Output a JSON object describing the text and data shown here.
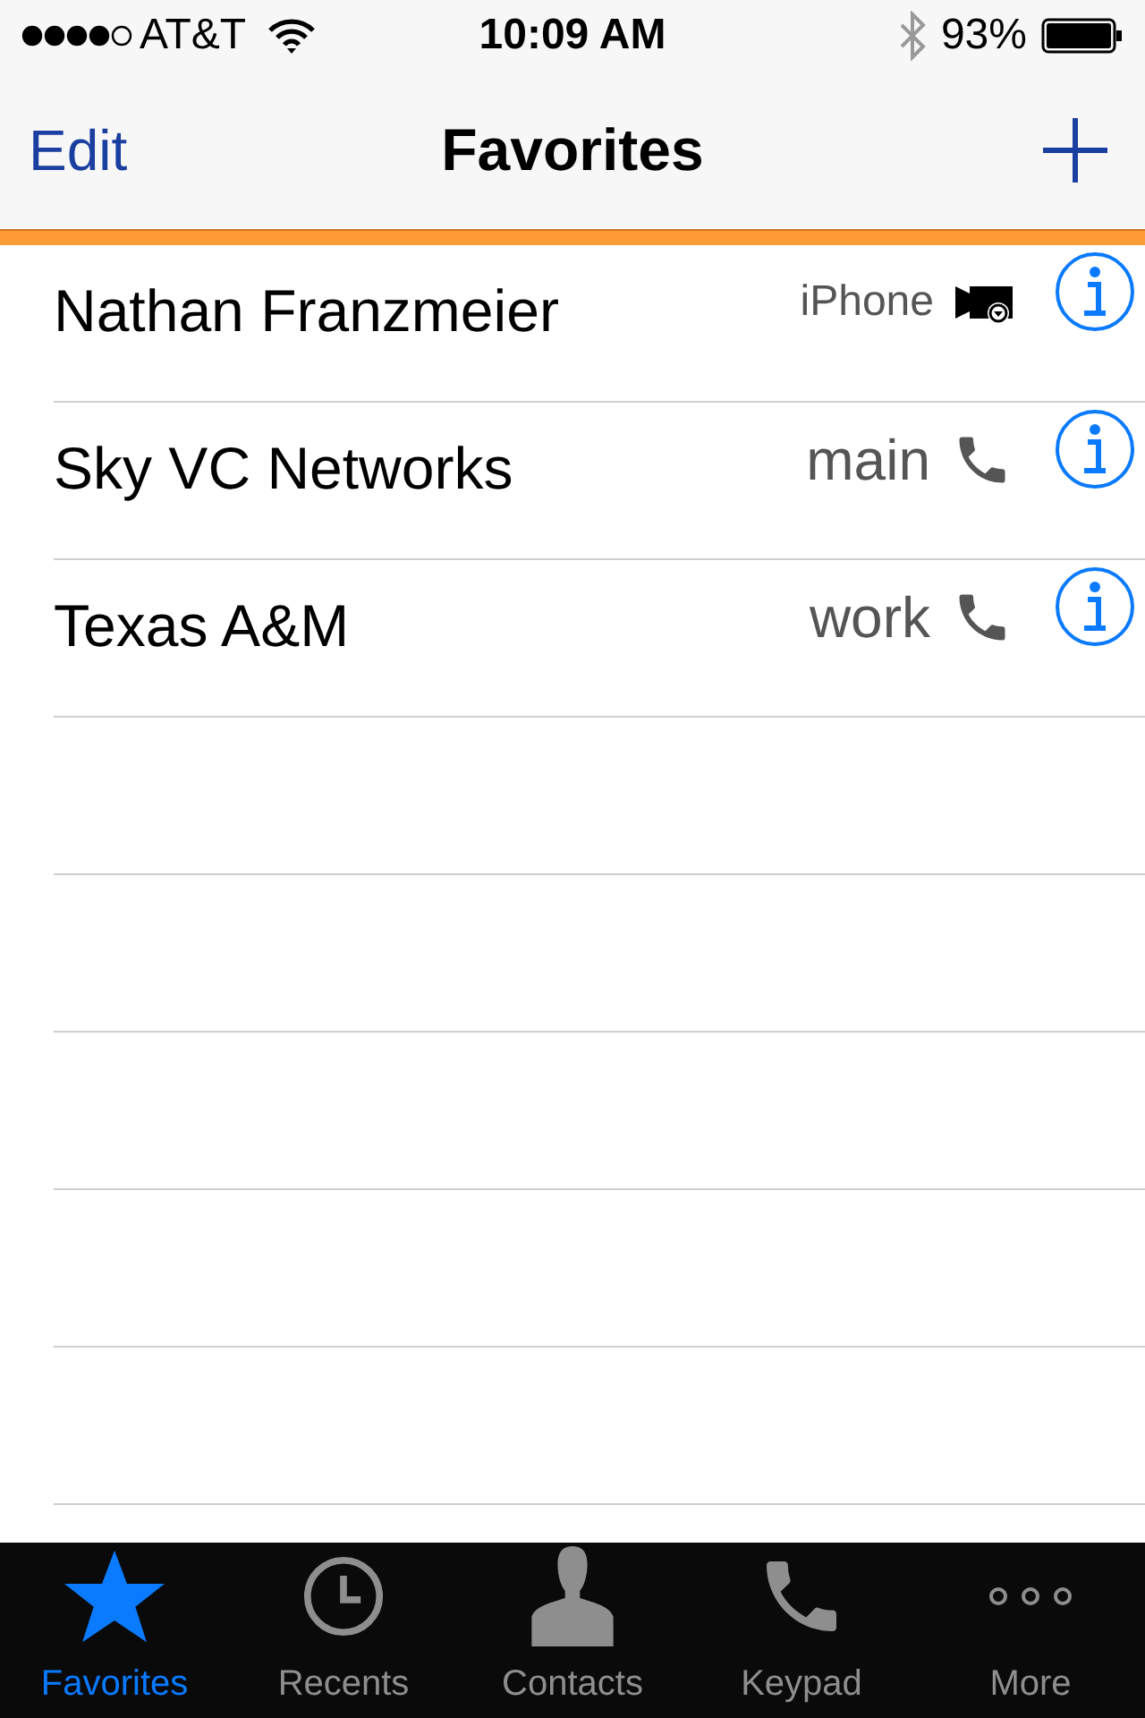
{
  "status_bar": {
    "carrier": "AT&T",
    "time": "10:09 AM",
    "battery": "93%"
  },
  "nav": {
    "left": "Edit",
    "title": "Favorites"
  },
  "favorites": [
    {
      "name": "Nathan Franzmeier",
      "label": "iPhone",
      "kind": "facetime"
    },
    {
      "name": "Sky VC Networks",
      "label": "main",
      "kind": "phone"
    },
    {
      "name": "Texas A&M",
      "label": "work",
      "kind": "phone"
    }
  ],
  "tabs": [
    {
      "label": "Favorites",
      "kind": "star",
      "selected": true
    },
    {
      "label": "Recents",
      "kind": "clock",
      "selected": false
    },
    {
      "label": "Contacts",
      "kind": "person",
      "selected": false
    },
    {
      "label": "Keypad",
      "kind": "phone",
      "selected": false
    },
    {
      "label": "More",
      "kind": "more",
      "selected": false
    }
  ]
}
